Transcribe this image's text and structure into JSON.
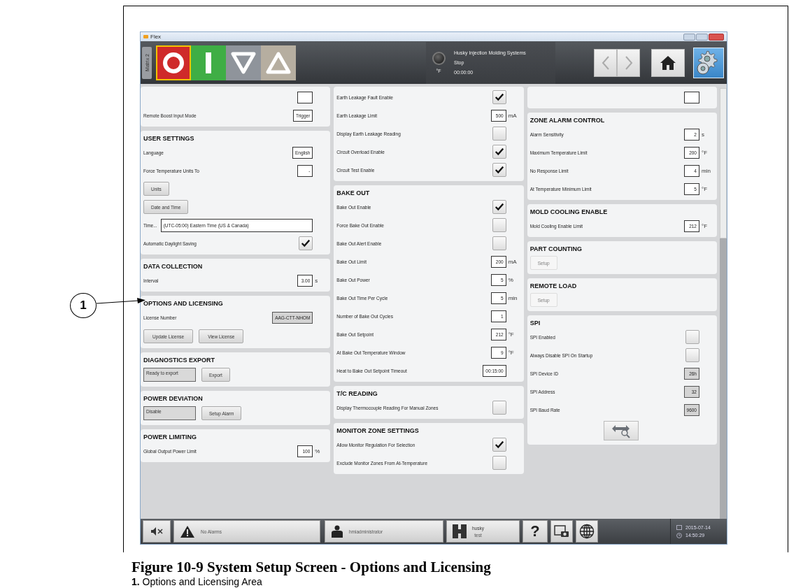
{
  "window": {
    "title": "Flex"
  },
  "header": {
    "side_tab": "Matrix 2",
    "mode_buttons": [
      {
        "kind": "stop",
        "selected": true
      },
      {
        "kind": "start",
        "selected": false
      },
      {
        "kind": "down",
        "selected": false
      },
      {
        "kind": "up",
        "selected": false
      }
    ],
    "status": {
      "unit": "°F",
      "company": "Husky Injection Molding Systems",
      "state": "Stop",
      "elapsed": "00:00:00"
    },
    "nav_buttons": [
      {
        "kind": "back",
        "selected": false
      },
      {
        "kind": "forward",
        "selected": false
      },
      {
        "kind": "home",
        "selected": false
      },
      {
        "kind": "settings",
        "selected": true
      }
    ]
  },
  "columns": [
    {
      "sections": [
        {
          "items": [
            {
              "kind": "field"
            },
            {
              "kind": "field",
              "label": "Remote Boost Input Mode",
              "value": "Trigger"
            }
          ]
        },
        {
          "heading": "USER SETTINGS",
          "items": [
            {
              "kind": "field",
              "label": "Language",
              "value": "English"
            },
            {
              "kind": "field",
              "label": "Force Temperature Units To",
              "value": "-"
            },
            {
              "kind": "button",
              "label": "Units",
              "disabled": false
            },
            {
              "kind": "button",
              "label": "Date and Time",
              "disabled": false
            },
            {
              "kind": "wide-field",
              "label": "Time...",
              "value": "(UTC-05:00) Eastern Time (US & Canada)"
            },
            {
              "kind": "check",
              "label": "Automatic Daylight Saving",
              "checked": true
            }
          ]
        },
        {
          "heading": "DATA COLLECTION",
          "items": [
            {
              "kind": "field",
              "label": "Interval",
              "value": "3.00",
              "unit": "s"
            }
          ]
        },
        {
          "heading": "OPTIONS AND LICENSING",
          "items": [
            {
              "kind": "readonly",
              "label": "License Number",
              "value": "AAG-CTT-NHOM"
            },
            {
              "kind": "buttons",
              "buttons": [
                "Update License",
                "View License"
              ]
            }
          ]
        },
        {
          "heading": "DIAGNOSTICS EXPORT",
          "items": [
            {
              "kind": "status",
              "value": "Ready to export",
              "button": "Export"
            }
          ]
        },
        {
          "heading": "POWER DEVIATION",
          "items": [
            {
              "kind": "status",
              "value": "Disable",
              "button": "Setup Alarm"
            }
          ]
        },
        {
          "heading": "POWER LIMITING",
          "items": [
            {
              "kind": "field",
              "label": "Global Output Power Limit",
              "value": "100",
              "unit": "%"
            }
          ]
        }
      ]
    },
    {
      "sections": [
        {
          "items": [
            {
              "kind": "check",
              "label": "Earth Leakage Fault Enable",
              "checked": true
            },
            {
              "kind": "field",
              "label": "Earth Leakage Limit",
              "value": "500",
              "unit": "mA"
            },
            {
              "kind": "check",
              "label": "Display Earth Leakage Reading",
              "checked": false
            },
            {
              "kind": "check",
              "label": "Circuit Overload Enable",
              "checked": true
            },
            {
              "kind": "check",
              "label": "Circuit Test Enable",
              "checked": true
            }
          ]
        },
        {
          "heading": "BAKE OUT",
          "items": [
            {
              "kind": "check",
              "label": "Bake Out Enable",
              "checked": true
            },
            {
              "kind": "check",
              "label": "Force Bake Out Enable",
              "checked": false
            },
            {
              "kind": "check",
              "label": "Bake Out Alert Enable",
              "checked": false
            },
            {
              "kind": "field",
              "label": "Bake Out Limit",
              "value": "200",
              "unit": "mA"
            },
            {
              "kind": "field",
              "label": "Bake Out Power",
              "value": "5",
              "unit": "%"
            },
            {
              "kind": "field",
              "label": "Bake Out Time Per Cycle",
              "value": "5",
              "unit": "min"
            },
            {
              "kind": "field",
              "label": "Number of Bake Out Cycles",
              "value": "1"
            },
            {
              "kind": "field",
              "label": "Bake Out Setpoint",
              "value": "212",
              "unit": "°F"
            },
            {
              "kind": "field",
              "label": "At Bake Out Temperature Window",
              "value": "9",
              "unit": "°F"
            },
            {
              "kind": "field",
              "label": "Heat to Bake Out Setpoint Timeout",
              "value": "00:15:00"
            }
          ]
        },
        {
          "heading": "T/C READING",
          "items": [
            {
              "kind": "check",
              "label": "Display Thermocouple Reading For Manual Zones",
              "checked": false
            }
          ]
        },
        {
          "heading": "MONITOR ZONE SETTINGS",
          "items": [
            {
              "kind": "check",
              "label": "Allow Monitor Regulation For Selection",
              "checked": true
            },
            {
              "kind": "check",
              "label": "Exclude Monitor Zones From At-Temperature",
              "checked": false
            }
          ]
        }
      ]
    },
    {
      "sections": [
        {
          "items": [
            {
              "kind": "field"
            }
          ]
        },
        {
          "heading": "ZONE ALARM CONTROL",
          "items": [
            {
              "kind": "field",
              "label": "Alarm Sensitivity",
              "value": "2",
              "unit": "s"
            },
            {
              "kind": "field",
              "label": "Maximum Temperature Limit",
              "value": "200",
              "unit": "°F"
            },
            {
              "kind": "field",
              "label": "No Response Limit",
              "value": "4",
              "unit": "min"
            },
            {
              "kind": "field",
              "label": "At Temperature Minimum Limit",
              "value": "5",
              "unit": "°F"
            }
          ]
        },
        {
          "heading": "MOLD COOLING ENABLE",
          "items": [
            {
              "kind": "field",
              "label": "Mold Cooling Enable Limit",
              "value": "212",
              "unit": "°F"
            }
          ]
        },
        {
          "heading": "PART COUNTING",
          "items": [
            {
              "kind": "button",
              "label": "Setup",
              "disabled": true
            }
          ]
        },
        {
          "heading": "REMOTE LOAD",
          "items": [
            {
              "kind": "button",
              "label": "Setup",
              "disabled": true
            }
          ]
        },
        {
          "heading": "SPI",
          "items": [
            {
              "kind": "check",
              "label": "SPI Enabled",
              "checked": false
            },
            {
              "kind": "check",
              "label": "Always Disable SPI On Startup",
              "checked": false
            },
            {
              "kind": "readonly",
              "label": "SPI Device ID",
              "value": "26h"
            },
            {
              "kind": "readonly",
              "label": "SPI Address",
              "value": "32"
            },
            {
              "kind": "readonly",
              "label": "SPI Baud Rate",
              "value": "9600"
            },
            {
              "kind": "icon-button"
            }
          ]
        }
      ]
    }
  ],
  "footer": {
    "buttons": [
      {
        "kind": "mute"
      },
      {
        "kind": "alarms",
        "label": "No Alarms"
      },
      {
        "kind": "user",
        "label": "hmiadministrator"
      },
      {
        "kind": "mold",
        "label": "husky",
        "sublabel": "test"
      },
      {
        "kind": "help",
        "label": "?"
      },
      {
        "kind": "screenshot"
      },
      {
        "kind": "language"
      }
    ],
    "date": "2015-07-14",
    "time": "14:50:29"
  },
  "callouts": [
    {
      "label": "1"
    }
  ],
  "caption": {
    "title": "Figure 10-9 System Setup Screen - Options and Licensing",
    "items": [
      "**1.** Options and Licensing Area"
    ]
  }
}
